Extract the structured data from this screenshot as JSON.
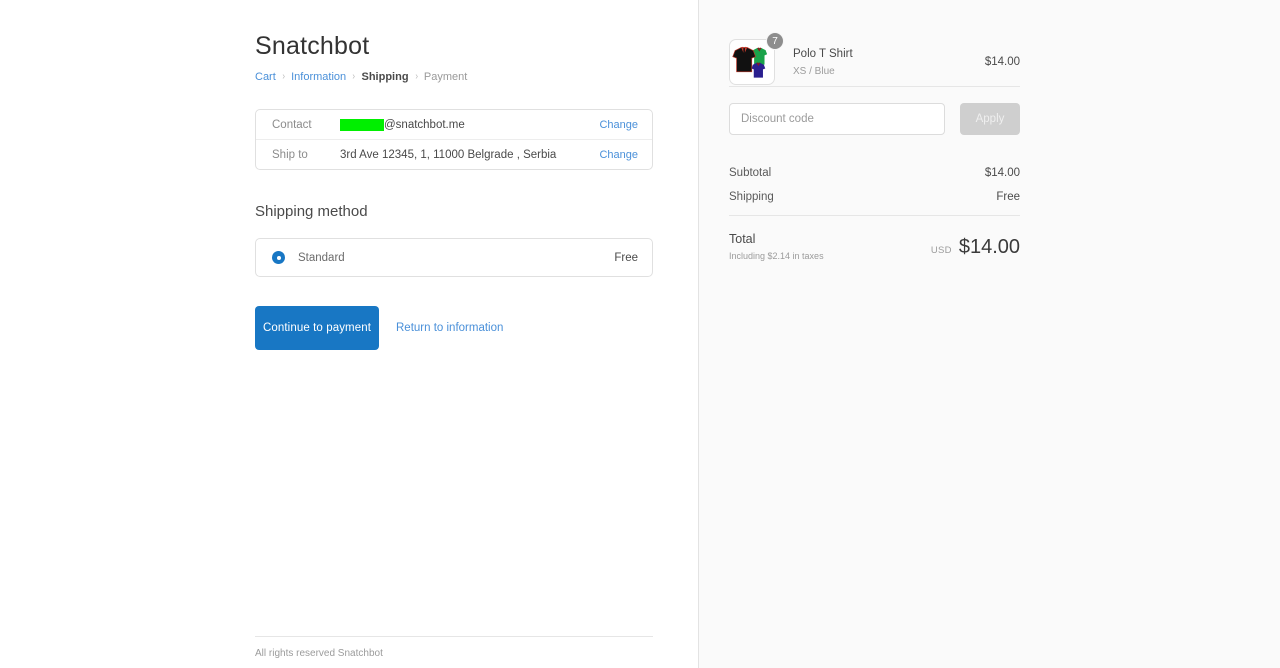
{
  "store": {
    "title": "Snatchbot"
  },
  "breadcrumb": {
    "items": [
      {
        "label": "Cart",
        "state": "link"
      },
      {
        "label": "Information",
        "state": "link"
      },
      {
        "label": "Shipping",
        "state": "current"
      },
      {
        "label": "Payment",
        "state": "muted"
      }
    ],
    "separator": "›"
  },
  "summary_box": {
    "contact_label": "Contact",
    "contact_value_suffix": "@snatchbot.me",
    "contact_redacted_color": "#00ef00",
    "contact_change_label": "Change",
    "ship_label": "Ship to",
    "ship_value": "3rd Ave 12345, 1, 11000 Belgrade , Serbia",
    "ship_change_label": "Change"
  },
  "shipping_method": {
    "heading": "Shipping method",
    "option_label": "Standard",
    "option_price": "Free",
    "selected": true
  },
  "actions": {
    "continue_label": "Continue to payment",
    "return_label": "Return to information"
  },
  "footer": {
    "text": "All rights reserved Snatchbot"
  },
  "order_summary": {
    "line_items": [
      {
        "title": "Polo T Shirt",
        "variant": "XS / Blue",
        "quantity": "7",
        "price": "$14.00"
      }
    ],
    "discount": {
      "placeholder": "Discount code",
      "value": "",
      "apply_label": "Apply"
    },
    "totals": [
      {
        "label": "Subtotal",
        "value": "$14.00"
      },
      {
        "label": "Shipping",
        "value": "Free"
      }
    ],
    "grand_total": {
      "label": "Total",
      "tax_note": "Including $2.14 in taxes",
      "currency": "USD",
      "value": "$14.00"
    }
  },
  "colors": {
    "accent": "#1877c4",
    "link": "#4a90d9",
    "panel_bg": "#fafafa",
    "badge_bg": "#8d8d8d",
    "disabled_button": "#cfcfcf"
  }
}
